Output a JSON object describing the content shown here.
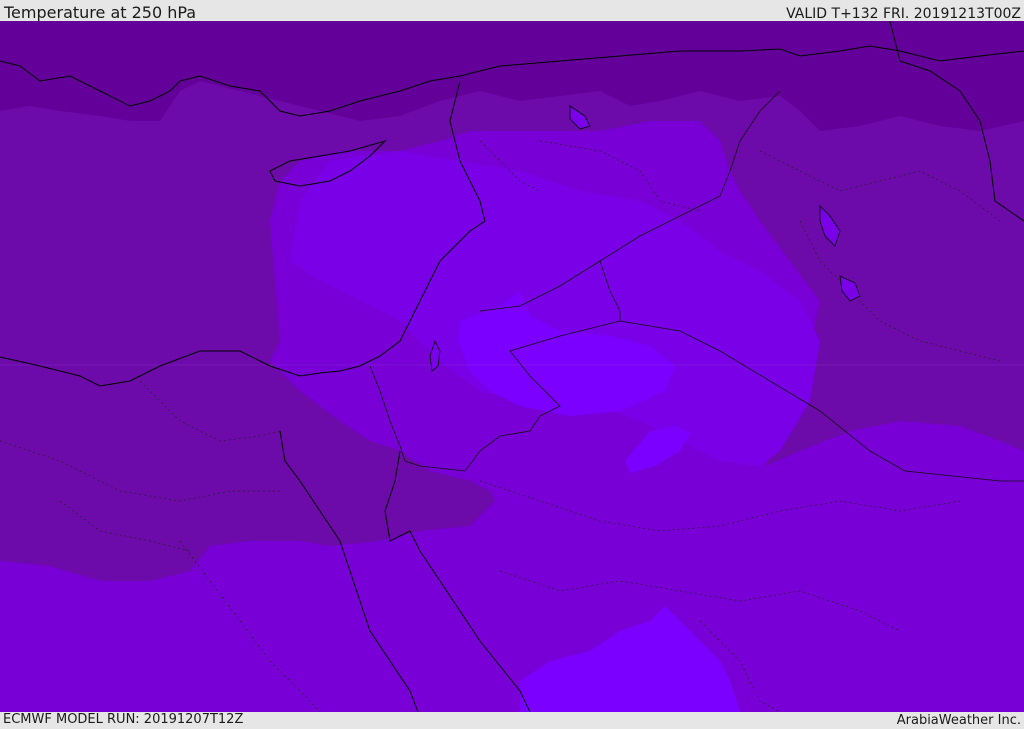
{
  "header": {
    "title": "Temperature at 250 hPa",
    "valid": "VALID T+132 FRI. 20191213T00Z"
  },
  "footer": {
    "model_run": "ECMWF MODEL RUN: 20191207T12Z",
    "credit": "ArabiaWeather Inc."
  },
  "map": {
    "colors": {
      "coldest": "#64009a",
      "cold": "#6d0aaa",
      "mid": "#7800d6",
      "warm": "#7a00e8",
      "warmest": "#7c00ff",
      "coastline": "#000000",
      "border": "#1a1a1a"
    }
  }
}
